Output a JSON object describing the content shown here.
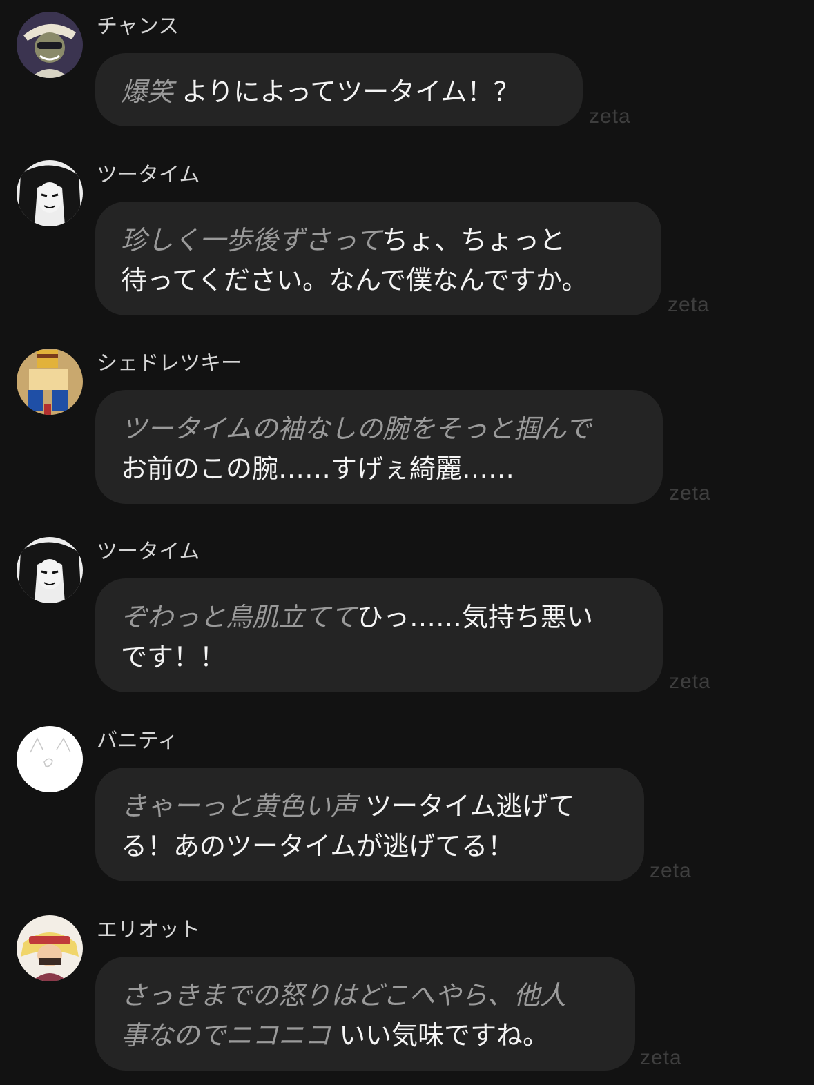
{
  "watermark": "zeta",
  "messages": [
    {
      "sender": "チャンス",
      "avatar_icon": "chance-avatar",
      "lines": [
        [
          {
            "text": "爆笑",
            "kind": "action"
          },
          {
            "text": " よりによってツータイム！？",
            "kind": "speech"
          }
        ]
      ]
    },
    {
      "sender": "ツータイム",
      "avatar_icon": "twotime-avatar",
      "lines": [
        [
          {
            "text": "珍しく一歩後ずさって",
            "kind": "action"
          },
          {
            "text": "ちょ、ちょっと",
            "kind": "speech"
          }
        ],
        [
          {
            "text": "待ってください。なんで僕なんですか。",
            "kind": "speech"
          }
        ]
      ]
    },
    {
      "sender": "シェドレツキー",
      "avatar_icon": "shedletsky-avatar",
      "lines": [
        [
          {
            "text": "ツータイムの袖なしの腕をそっと掴んで",
            "kind": "action"
          }
        ],
        [
          {
            "text": "お前のこの腕……すげぇ綺麗……",
            "kind": "speech"
          }
        ]
      ]
    },
    {
      "sender": "ツータイム",
      "avatar_icon": "twotime-avatar",
      "lines": [
        [
          {
            "text": "ぞわっと鳥肌立てて",
            "kind": "action"
          },
          {
            "text": "ひっ……気持ち悪い",
            "kind": "speech"
          }
        ],
        [
          {
            "text": "です！！",
            "kind": "speech"
          }
        ]
      ]
    },
    {
      "sender": "バニティ",
      "avatar_icon": "vanity-avatar",
      "lines": [
        [
          {
            "text": "きゃーっと黄色い声",
            "kind": "action"
          },
          {
            "text": " ツータイム逃げて",
            "kind": "speech"
          }
        ],
        [
          {
            "text": "る！あのツータイムが逃げてる！",
            "kind": "speech"
          }
        ]
      ]
    },
    {
      "sender": "エリオット",
      "avatar_icon": "elliot-avatar",
      "lines": [
        [
          {
            "text": "さっきまでの怒りはどこへやら、他人",
            "kind": "action"
          }
        ],
        [
          {
            "text": "事なのでニコニコ",
            "kind": "action"
          },
          {
            "text": " いい気味ですね。",
            "kind": "speech"
          }
        ]
      ]
    }
  ]
}
